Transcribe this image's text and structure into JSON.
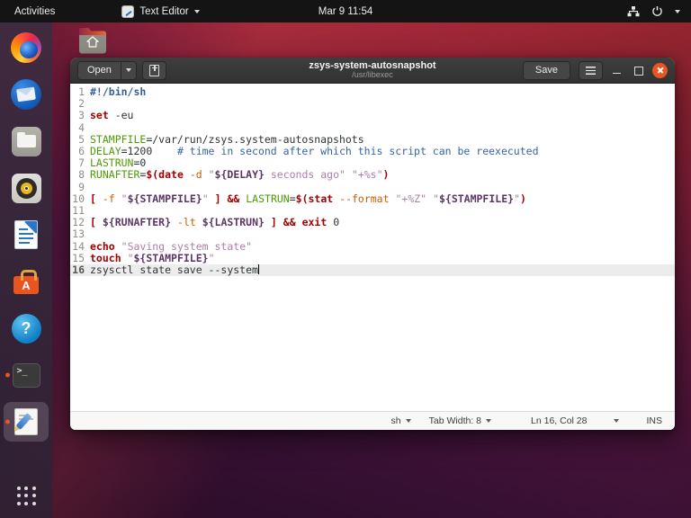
{
  "topbar": {
    "activities_label": "Activities",
    "app_menu_label": "Text Editor",
    "clock": "Mar 9 11:54"
  },
  "dock": {
    "items": [
      "Firefox",
      "Thunderbird",
      "Files",
      "Rhythmbox",
      "LibreOffice Writer",
      "Ubuntu Software",
      "Help",
      "Terminal",
      "Text Editor",
      "Show Applications"
    ]
  },
  "window": {
    "open_label": "Open",
    "title": "zsys-system-autosnapshot",
    "subtitle": "/usr/libexec",
    "save_label": "Save",
    "statusbar": {
      "language": "sh",
      "tab_width_label": "Tab Width: 8",
      "cursor_position": "Ln 16, Col 28",
      "input_mode": "INS"
    }
  },
  "editor": {
    "cursor": {
      "line": 16,
      "col": 28
    },
    "current_line": 16,
    "lines": [
      [
        [
          "sb",
          "#!/bin/sh"
        ]
      ],
      [],
      [
        [
          "kw",
          "set"
        ],
        [
          "d",
          " -eu"
        ]
      ],
      [],
      [
        [
          "var",
          "STAMPFILE"
        ],
        [
          "d",
          "=/var/run/zsys.system-autosnapshots"
        ]
      ],
      [
        [
          "var",
          "DELAY"
        ],
        [
          "d",
          "=1200    "
        ],
        [
          "cm",
          "# time in second after which this script can be reexecuted"
        ]
      ],
      [
        [
          "var",
          "LASTRUN"
        ],
        [
          "d",
          "=0"
        ]
      ],
      [
        [
          "var",
          "RUNAFTER"
        ],
        [
          "d",
          "="
        ],
        [
          "kw",
          "$(date"
        ],
        [
          "d",
          " "
        ],
        [
          "opt",
          "-d"
        ],
        [
          "d",
          " "
        ],
        [
          "str",
          "\""
        ],
        [
          "pvar",
          "${DELAY}"
        ],
        [
          "str",
          " seconds ago\""
        ],
        [
          "d",
          " "
        ],
        [
          "str",
          "\"+%s\""
        ],
        [
          "kw",
          ")"
        ]
      ],
      [],
      [
        [
          "kw",
          "["
        ],
        [
          "d",
          " "
        ],
        [
          "opt",
          "-f"
        ],
        [
          "d",
          " "
        ],
        [
          "str",
          "\""
        ],
        [
          "pvar",
          "${STAMPFILE}"
        ],
        [
          "str",
          "\""
        ],
        [
          "d",
          " "
        ],
        [
          "kw",
          "]"
        ],
        [
          "d",
          " "
        ],
        [
          "kw",
          "&&"
        ],
        [
          "d",
          " "
        ],
        [
          "var",
          "LASTRUN"
        ],
        [
          "d",
          "="
        ],
        [
          "kw",
          "$(stat"
        ],
        [
          "d",
          " "
        ],
        [
          "opt",
          "--format"
        ],
        [
          "d",
          " "
        ],
        [
          "str",
          "\"+%Z\""
        ],
        [
          "d",
          " "
        ],
        [
          "str",
          "\""
        ],
        [
          "pvar",
          "${STAMPFILE}"
        ],
        [
          "str",
          "\""
        ],
        [
          "kw",
          ")"
        ]
      ],
      [],
      [
        [
          "kw",
          "["
        ],
        [
          "d",
          " "
        ],
        [
          "pvar",
          "${RUNAFTER}"
        ],
        [
          "d",
          " "
        ],
        [
          "opt",
          "-lt"
        ],
        [
          "d",
          " "
        ],
        [
          "pvar",
          "${LASTRUN}"
        ],
        [
          "d",
          " "
        ],
        [
          "kw",
          "]"
        ],
        [
          "d",
          " "
        ],
        [
          "kw",
          "&&"
        ],
        [
          "d",
          " "
        ],
        [
          "kw",
          "exit"
        ],
        [
          "d",
          " 0"
        ]
      ],
      [],
      [
        [
          "kw",
          "echo"
        ],
        [
          "d",
          " "
        ],
        [
          "str",
          "\"Saving system state\""
        ]
      ],
      [
        [
          "kw",
          "touch"
        ],
        [
          "d",
          " "
        ],
        [
          "str",
          "\""
        ],
        [
          "pvar",
          "${STAMPFILE}"
        ],
        [
          "str",
          "\""
        ]
      ],
      [
        [
          "d",
          "zsysctl state save --system"
        ]
      ]
    ]
  },
  "colors": {
    "accent_orange": "#e95420",
    "topbar_bg": "#141414",
    "dock_bg": "#352740",
    "header_bg": "#383838",
    "editor_bg": "#ffffff",
    "current_line_bg": "#ececec",
    "syntax": {
      "d": "#2e3436",
      "sb": "#36609c",
      "kw": "#a40000",
      "var": "#4e9a06",
      "opt": "#ce5c00",
      "str": "#ad7fa8",
      "pvar": "#5c3566",
      "cm": "#3465a4",
      "gutter": "#8d8d86"
    }
  }
}
